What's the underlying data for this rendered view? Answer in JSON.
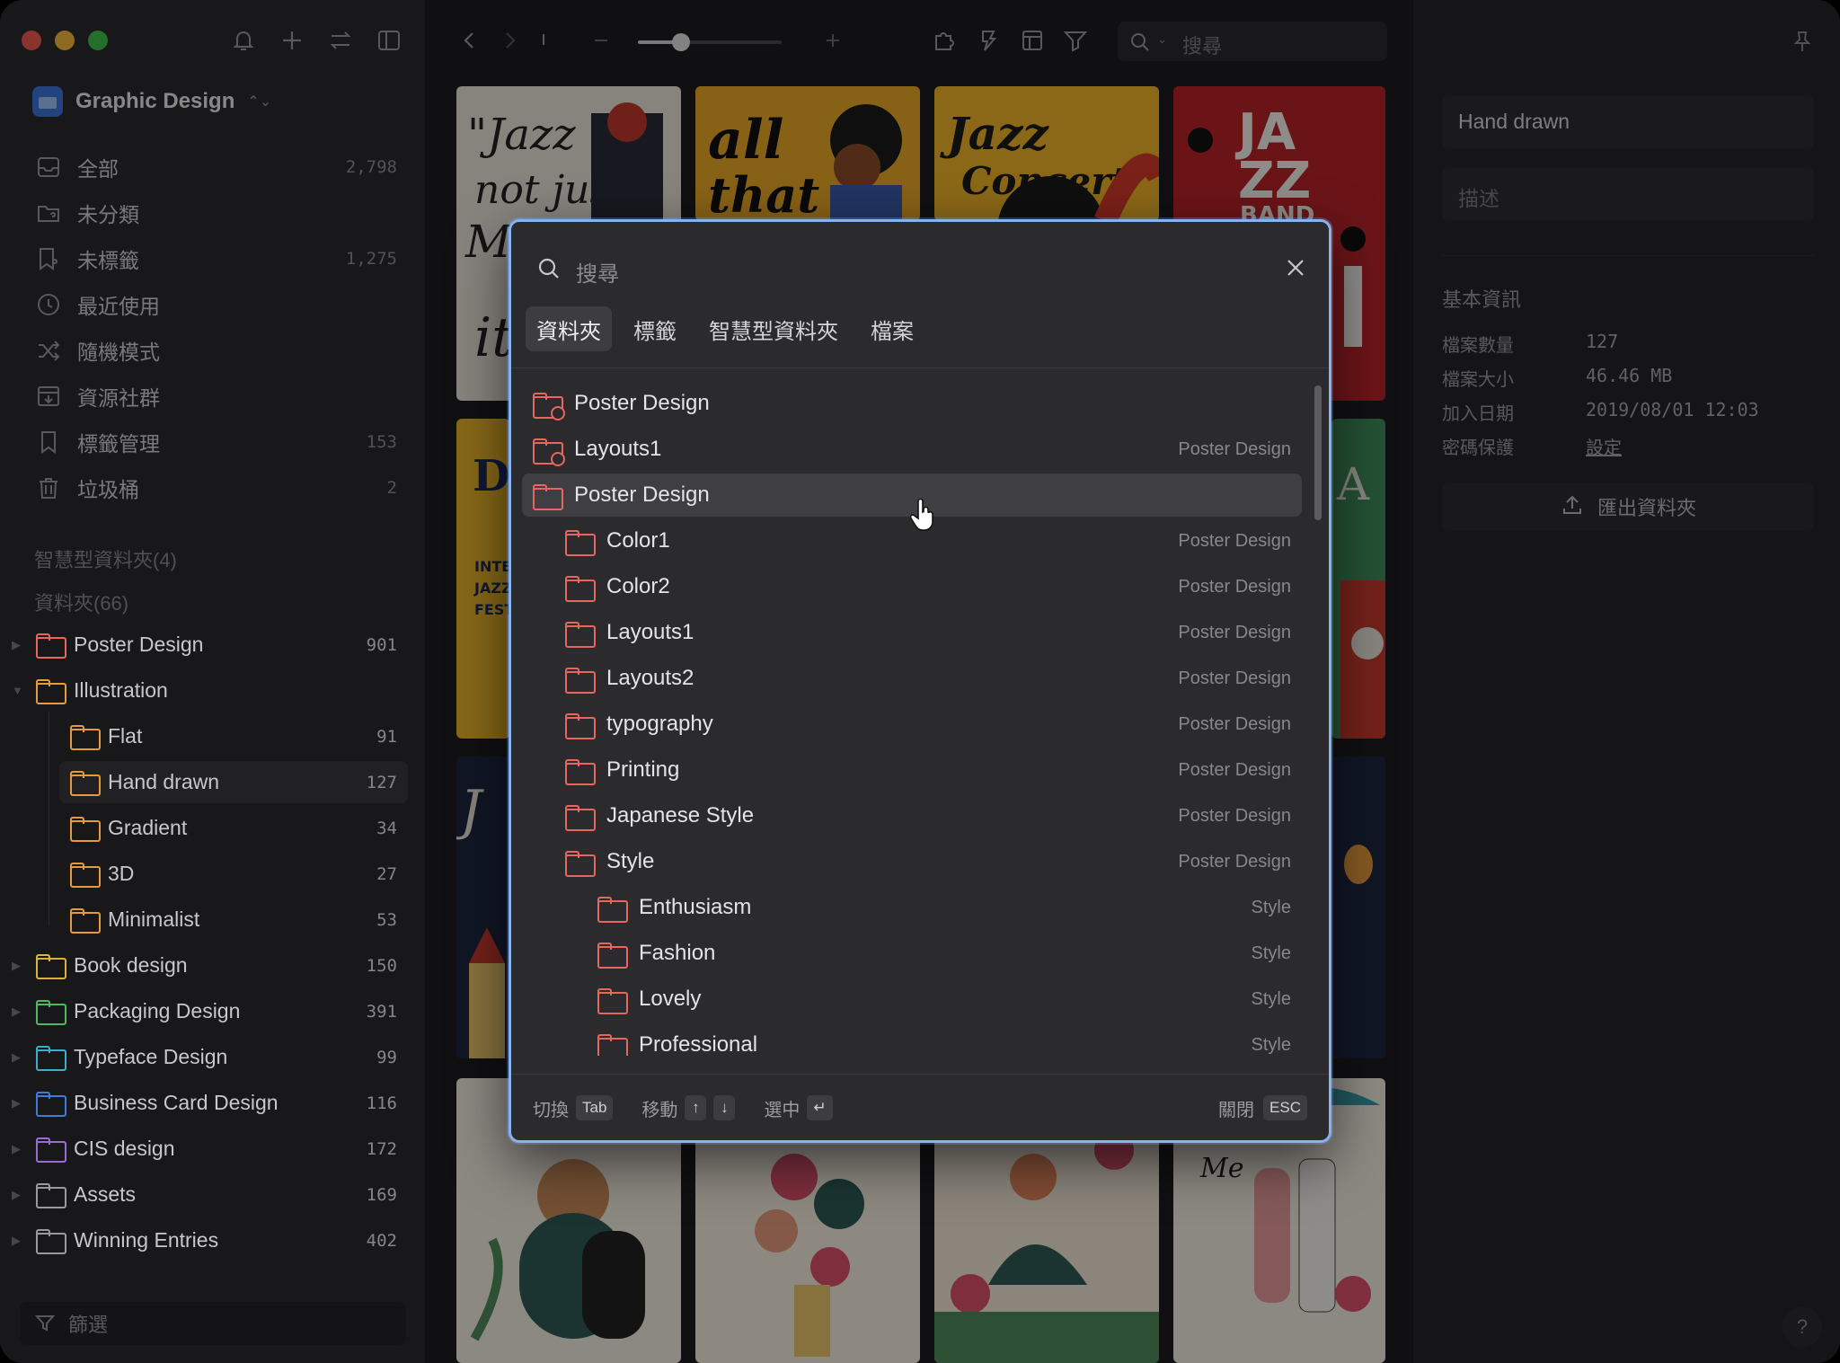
{
  "colors": {
    "accent": "#86b3ee",
    "folder_red": "#e5675e",
    "folder_orange": "#e59a3d",
    "folder_yellow": "#d9b43c",
    "folder_green": "#4eb864",
    "folder_teal": "#3ab0c7",
    "folder_blue": "#3b7ed9",
    "folder_purple": "#9a6bd6",
    "folder_gray": "#9a9a9e"
  },
  "sidebar": {
    "library_name": "Graphic Design",
    "nav": [
      {
        "label": "全部",
        "count": "2,798",
        "icon": "inbox-icon"
      },
      {
        "label": "未分類",
        "count": "",
        "icon": "folder-question-icon"
      },
      {
        "label": "未標籤",
        "count": "1,275",
        "icon": "tag-question-icon"
      },
      {
        "label": "最近使用",
        "count": "",
        "icon": "clock-icon"
      },
      {
        "label": "隨機模式",
        "count": "",
        "icon": "shuffle-icon"
      },
      {
        "label": "資源社群",
        "count": "",
        "icon": "download-box-icon"
      },
      {
        "label": "標籤管理",
        "count": "153",
        "icon": "bookmark-icon"
      },
      {
        "label": "垃圾桶",
        "count": "2",
        "icon": "trash-icon"
      }
    ],
    "smart_folders_header": "智慧型資料夾(4)",
    "folders_header": "資料夾(66)",
    "folders": [
      {
        "label": "Poster Design",
        "count": "901",
        "color": "#e5675e",
        "level": 0,
        "arrow": "▶"
      },
      {
        "label": "Illustration",
        "count": "",
        "color": "#e59a3d",
        "level": 0,
        "arrow": "▼"
      },
      {
        "label": "Flat",
        "count": "91",
        "color": "#e59a3d",
        "level": 1,
        "arrow": ""
      },
      {
        "label": "Hand drawn",
        "count": "127",
        "color": "#e59a3d",
        "level": 1,
        "arrow": "",
        "selected": true
      },
      {
        "label": "Gradient",
        "count": "34",
        "color": "#e59a3d",
        "level": 1,
        "arrow": ""
      },
      {
        "label": "3D",
        "count": "27",
        "color": "#e59a3d",
        "level": 1,
        "arrow": ""
      },
      {
        "label": "Minimalist",
        "count": "53",
        "color": "#e59a3d",
        "level": 1,
        "arrow": ""
      },
      {
        "label": "Book design",
        "count": "150",
        "color": "#d9b43c",
        "level": 0,
        "arrow": "▶"
      },
      {
        "label": "Packaging Design",
        "count": "391",
        "color": "#4eb864",
        "level": 0,
        "arrow": "▶"
      },
      {
        "label": "Typeface Design",
        "count": "99",
        "color": "#3ab0c7",
        "level": 0,
        "arrow": "▶"
      },
      {
        "label": "Business Card Design",
        "count": "116",
        "color": "#3b7ed9",
        "level": 0,
        "arrow": "▶"
      },
      {
        "label": "CIS design",
        "count": "172",
        "color": "#9a6bd6",
        "level": 0,
        "arrow": "▶"
      },
      {
        "label": "Assets",
        "count": "169",
        "color": "#9a9a9e",
        "level": 0,
        "arrow": "▶"
      },
      {
        "label": "Winning Entries",
        "count": "402",
        "color": "#9a9a9e",
        "level": 0,
        "arrow": "▶"
      }
    ],
    "filter_label": "篩選"
  },
  "toolbar": {
    "search_placeholder": "搜尋",
    "zoom_level": 0.3
  },
  "inspector": {
    "name_value": "Hand drawn",
    "desc_placeholder": "描述",
    "section_title": "基本資訊",
    "rows": [
      {
        "key": "檔案數量",
        "value": "127"
      },
      {
        "key": "檔案大小",
        "value": "46.46 MB"
      },
      {
        "key": "加入日期",
        "value": "2019/08/01 12:03"
      },
      {
        "key": "密碼保護",
        "value": "設定"
      }
    ],
    "export_label": "匯出資料夾",
    "help": "?"
  },
  "dialog": {
    "search_placeholder": "搜尋",
    "tabs": [
      "資料夾",
      "標籤",
      "智慧型資料夾",
      "檔案"
    ],
    "active_tab": 0,
    "results": [
      {
        "name": "Poster Design",
        "path": "",
        "level": 0,
        "smart": true
      },
      {
        "name": "Layouts1",
        "path": "Poster Design",
        "level": 0,
        "smart": true
      },
      {
        "name": "Poster Design",
        "path": "",
        "level": 0,
        "smart": false,
        "hover": true
      },
      {
        "name": "Color1",
        "path": "Poster Design",
        "level": 1
      },
      {
        "name": "Color2",
        "path": "Poster Design",
        "level": 1
      },
      {
        "name": "Layouts1",
        "path": "Poster Design",
        "level": 1
      },
      {
        "name": "Layouts2",
        "path": "Poster Design",
        "level": 1
      },
      {
        "name": "typography",
        "path": "Poster Design",
        "level": 1
      },
      {
        "name": "Printing",
        "path": "Poster Design",
        "level": 1
      },
      {
        "name": "Japanese Style",
        "path": "Poster Design",
        "level": 1
      },
      {
        "name": "Style",
        "path": "Poster Design",
        "level": 1
      },
      {
        "name": "Enthusiasm",
        "path": "Style",
        "level": 2
      },
      {
        "name": "Fashion",
        "path": "Style",
        "level": 2
      },
      {
        "name": "Lovely",
        "path": "Style",
        "level": 2
      },
      {
        "name": "Professional",
        "path": "Style",
        "level": 2
      }
    ],
    "footer": {
      "switch_label": "切換",
      "switch_key": "Tab",
      "move_label": "移動",
      "move_key_up": "↑",
      "move_key_down": "↓",
      "select_label": "選中",
      "select_key": "↵",
      "close_label": "關閉",
      "close_key": "ESC"
    }
  }
}
